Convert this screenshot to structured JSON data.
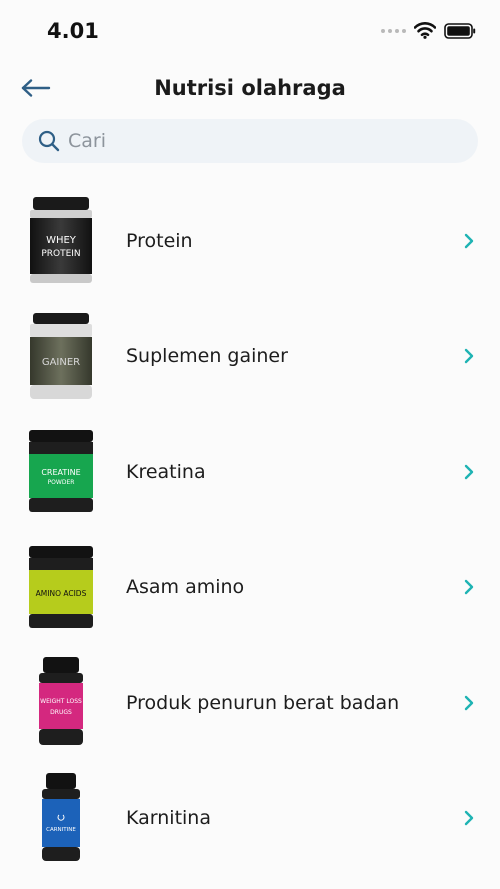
{
  "status_bar": {
    "time": "4.01",
    "icons": [
      "signal-dots-icon",
      "wifi-icon",
      "battery-icon"
    ]
  },
  "header": {
    "back_icon": "arrow-left-icon",
    "title": "Nutrisi olahraga"
  },
  "search": {
    "icon": "search-icon",
    "placeholder": "Cari",
    "value": ""
  },
  "items": [
    {
      "label": "Protein",
      "image": "whey-protein-jar",
      "jar_text": [
        "WHEY",
        "PROTEIN"
      ],
      "lid_color": "#1d1d1d",
      "body_color": "#2a2a2a",
      "label_color": "#111111",
      "text_color": "#ffffff"
    },
    {
      "label": "Suplemen gainer",
      "image": "gainer-jar",
      "jar_text": [
        "GAINER"
      ],
      "lid_color": "#1c1c1c",
      "body_color": "#d9d9d9",
      "label_color": "#4c4f40",
      "text_color": "#d8d8d8"
    },
    {
      "label": "Kreatina",
      "image": "creatine-jar",
      "jar_text": [
        "CREATINE",
        "POWDER"
      ],
      "lid_color": "#161616",
      "body_color": "#1e1e1e",
      "label_color": "#17a64f",
      "text_color": "#ffffff"
    },
    {
      "label": "Asam amino",
      "image": "amino-acids-jar",
      "jar_text": [
        "AMINO ACIDS"
      ],
      "lid_color": "#161616",
      "body_color": "#1e1e1e",
      "label_color": "#b6cc1c",
      "text_color": "#111111"
    },
    {
      "label": "Produk penurun berat badan",
      "image": "weight-loss-bottle",
      "jar_text": [
        "WEIGHT LOSS",
        "DRUGS"
      ],
      "lid_color": "#161616",
      "body_color": "#1e1e1e",
      "label_color": "#d4287f",
      "text_color": "#ffffff"
    },
    {
      "label": "Karnitina",
      "image": "carnitine-bottle",
      "jar_text": [
        "CARNITINE"
      ],
      "lid_color": "#161616",
      "body_color": "#1e1e1e",
      "label_color": "#1c62b9",
      "text_color": "#ffffff"
    }
  ],
  "colors": {
    "accent": "#1eb3b3",
    "back_arrow": "#2f5f86",
    "search_bg": "#eff3f7"
  }
}
